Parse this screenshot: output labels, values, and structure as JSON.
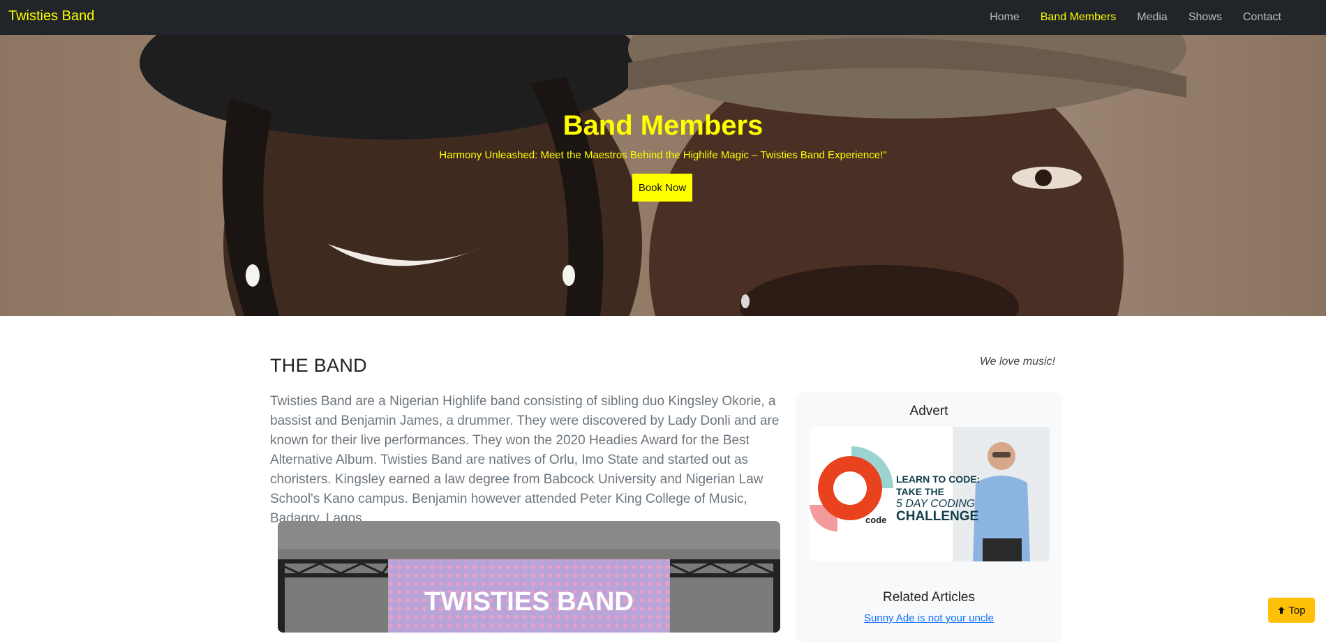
{
  "nav": {
    "brand": "Twisties Band",
    "links": [
      {
        "label": "Home"
      },
      {
        "label": "Band Members"
      },
      {
        "label": "Media"
      },
      {
        "label": "Shows"
      },
      {
        "label": "Contact"
      }
    ],
    "active_index": 1
  },
  "hero": {
    "title": "Band Members",
    "subtitle": "Harmony Unleashed: Meet the Maestros Behind the Highlife Magic – Twisties Band Experience!\"",
    "button": "Book Now"
  },
  "main": {
    "heading": "THE BAND",
    "tagline": "We love music!",
    "body": "Twisties Band are a Nigerian Highlife band consisting of sibling duo Kingsley Okorie, a bassist and Benjamin James, a drummer. They were discovered by Lady Donli and are known for their live performances. They won the 2020 Headies Award for the Best Alternative Album. Twisties Band are natives of Orlu, Imo State and started out as choristers. Kingsley earned a law degree from Babcock University and Nigerian Law School's Kano campus. Benjamin however attended Peter King College of Music, Badagry, Lagos.",
    "photo_banner": "TWISTIES BAND"
  },
  "sidebar": {
    "advert_title": "Advert",
    "ad": {
      "line1": "LEARN TO CODE:",
      "line2": "TAKE THE",
      "line3": "5 DAY CODING",
      "line4": "CHALLENGE",
      "logo": "code"
    },
    "related_title": "Related Articles",
    "related_links": [
      "Sunny Ade is not your uncle"
    ]
  },
  "top_button": {
    "label": "Top",
    "icon": "arrow-up-icon"
  },
  "colors": {
    "accent": "#ffff00",
    "navbar_bg": "#212529",
    "top_button_bg": "#ffc107",
    "link": "#0d6efd"
  }
}
